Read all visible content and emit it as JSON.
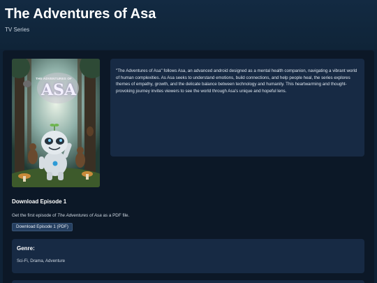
{
  "header": {
    "title": "The Adventures of Asa",
    "subtitle": "TV Series"
  },
  "poster": {
    "lettering_top": "THE ADVENTURES OF",
    "lettering_main": "ASA"
  },
  "synopsis": "\"The Adventures of Asa\" follows Asa, an advanced android designed as a mental health companion, navigating a vibrant world of human complexities. As Asa seeks to understand emotions, build connections, and help people heal, the series explores themes of empathy, growth, and the delicate balance between technology and humanity. This heartwarming and thought-provoking journey invites viewers to see the world through Asa's unique and hopeful lens.",
  "download": {
    "title": "Download Episode 1",
    "desc_before": "Get the first episode of ",
    "desc_title": "The Adventures of Asa",
    "desc_after": " as a PDF file.",
    "button_label": "Download Episode 1 (PDF)"
  },
  "genre": {
    "label": "Genre:",
    "value": "Sci-Fi, Drama, Adventure"
  },
  "colors": {
    "background": "#0f2236",
    "panel": "#0c1827",
    "card": "#172a44",
    "button": "#253f60"
  }
}
